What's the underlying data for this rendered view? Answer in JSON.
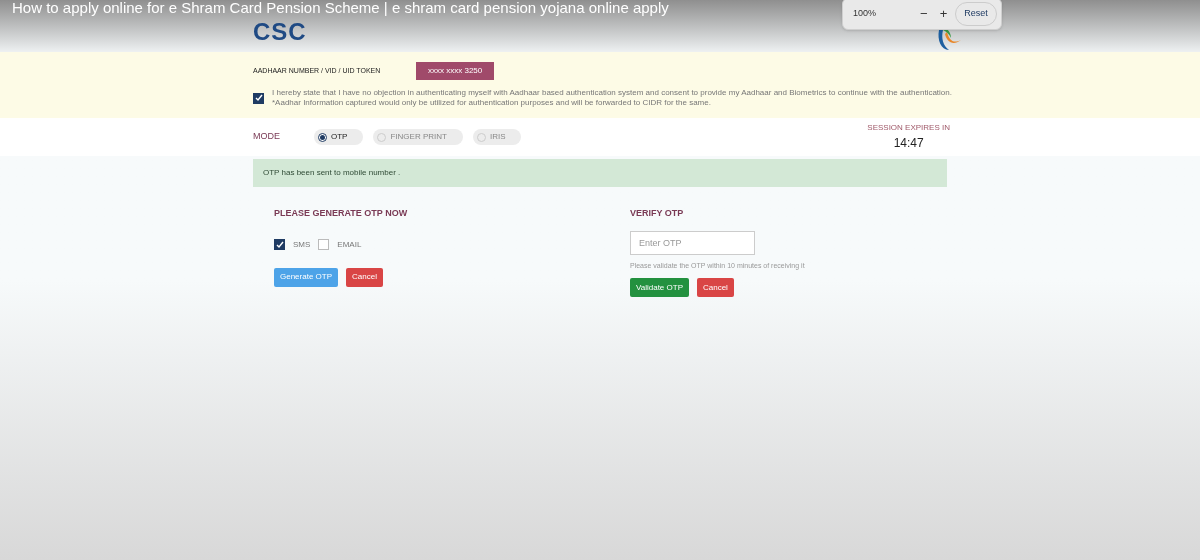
{
  "video_title": "How to apply online for e Shram Card Pension Scheme | e shram card pension yojana online apply",
  "logo": {
    "text": "CSC"
  },
  "zoom_popup": {
    "value": "100%",
    "minus": "−",
    "plus": "+",
    "reset": "Reset"
  },
  "aadhaar": {
    "label": "AADHAAR NUMBER / VID / UID TOKEN",
    "value": "xxxx xxxx 3250"
  },
  "consent": {
    "checked": true,
    "line1": "I hereby state that I have no objection in authenticating myself with Aadhaar based authentication system and consent to provide my Aadhaar and Biometrics to continue with the authentication.",
    "line2": "*Aadhar Information captured would only be utilized for authentication purposes and will be forwarded to CIDR for the same."
  },
  "mode": {
    "label": "MODE",
    "options": [
      {
        "label": "OTP",
        "selected": true
      },
      {
        "label": "FINGER PRINT",
        "selected": false
      },
      {
        "label": "IRIS",
        "selected": false
      }
    ]
  },
  "session": {
    "label": "SESSION EXPIRES IN",
    "time": "14:47"
  },
  "alert": "OTP has been sent to mobile number .",
  "generate": {
    "title": "PLEASE GENERATE OTP NOW",
    "channels": [
      {
        "label": "SMS",
        "checked": true
      },
      {
        "label": "EMAIL",
        "checked": false
      }
    ],
    "buttons": [
      {
        "label": "Generate OTP",
        "kind": "info"
      },
      {
        "label": "Cancel",
        "kind": "danger"
      }
    ]
  },
  "verify": {
    "title": "VERIFY OTP",
    "placeholder": "Enter OTP",
    "hint": "Please validate the OTP within 10 minutes of receiving it",
    "buttons": [
      {
        "label": "Validate OTP",
        "kind": "success"
      },
      {
        "label": "Cancel",
        "kind": "danger"
      }
    ]
  }
}
